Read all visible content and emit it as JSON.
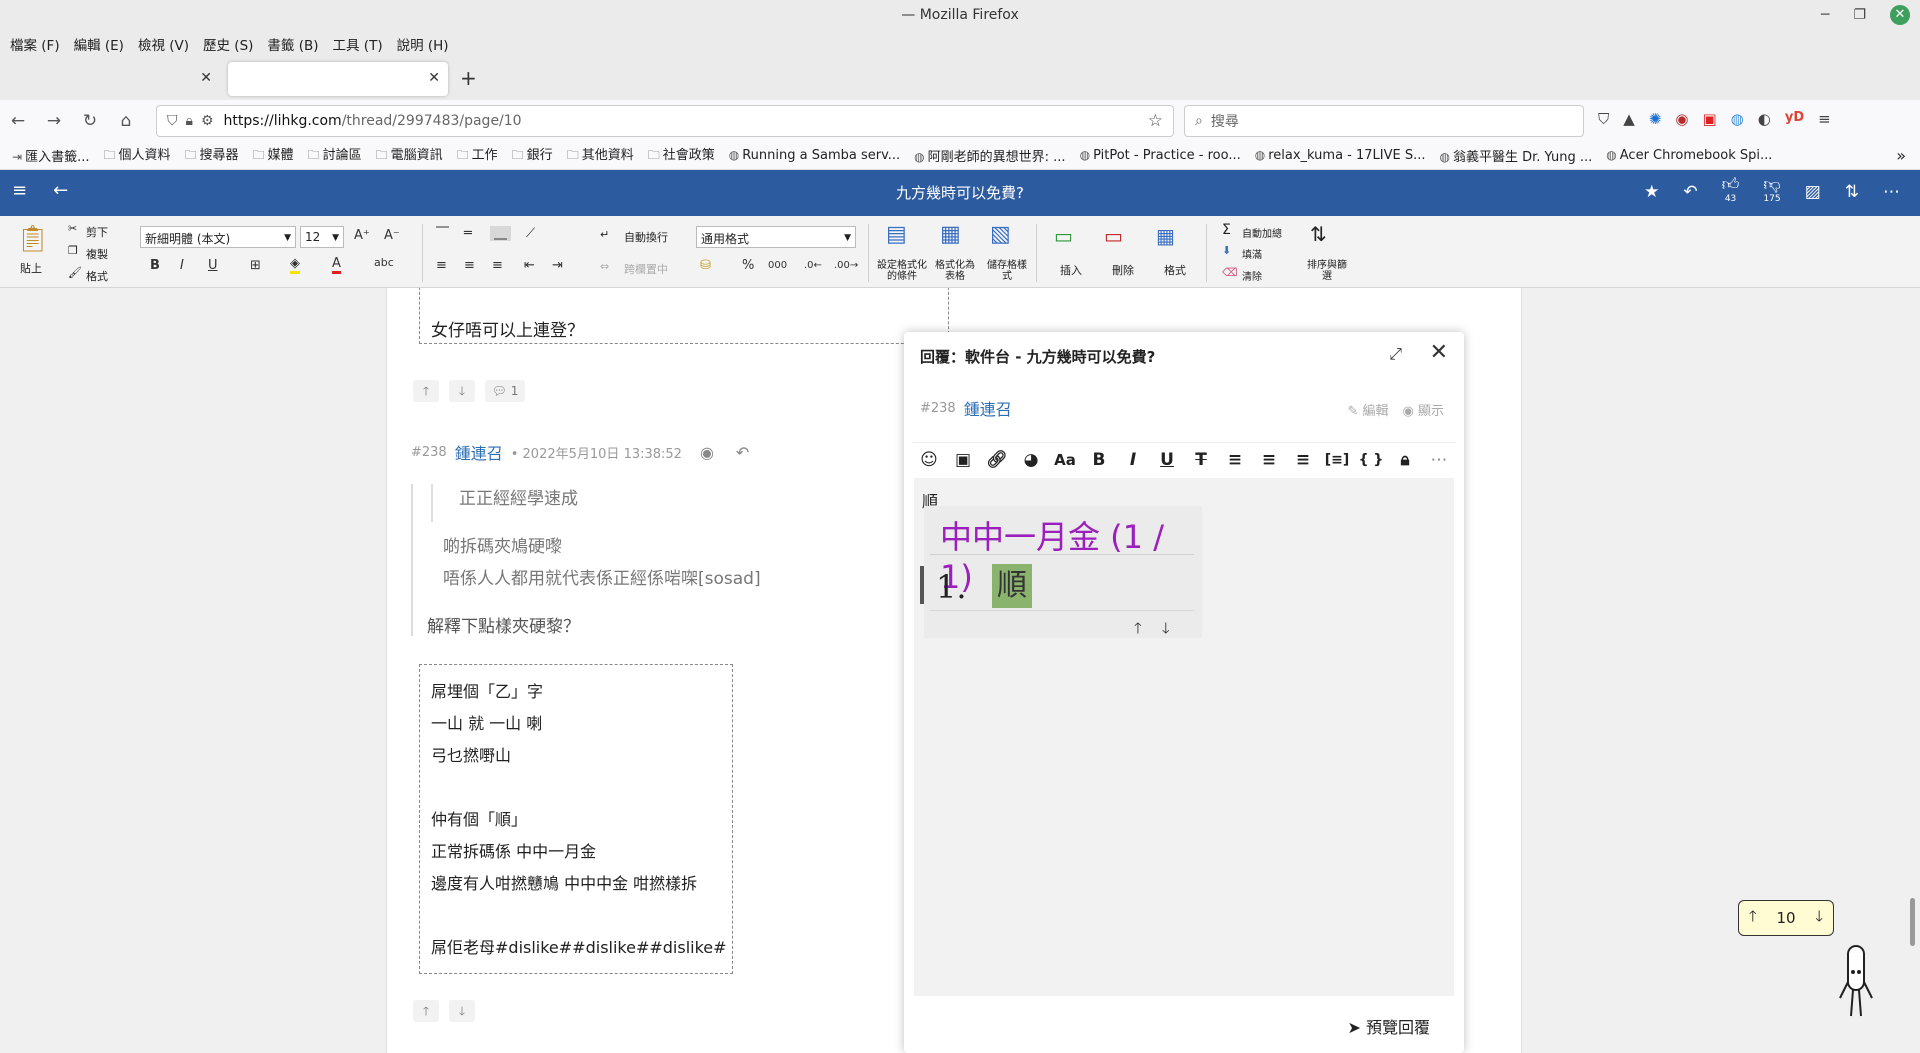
{
  "window": {
    "title": "— Mozilla Firefox"
  },
  "menu": [
    "檔案 (F)",
    "編輯 (E)",
    "檢視 (V)",
    "歷史 (S)",
    "書籤 (B)",
    "工具 (T)",
    "說明 (H)"
  ],
  "tabs": {
    "close_glyph": "✕",
    "new_tab": "+"
  },
  "urlbar": {
    "host": "https://lihkg.com",
    "path": "/thread/2997483/page/10"
  },
  "searchbar": {
    "placeholder": "搜尋"
  },
  "bookmarks": [
    {
      "icon": "import-icon",
      "label": "匯入書籤..."
    },
    {
      "icon": "folder-icon",
      "label": "個人資料"
    },
    {
      "icon": "folder-icon",
      "label": "搜尋器"
    },
    {
      "icon": "folder-icon",
      "label": "媒體"
    },
    {
      "icon": "folder-icon",
      "label": "討論區"
    },
    {
      "icon": "folder-icon",
      "label": "電腦資訊"
    },
    {
      "icon": "folder-icon",
      "label": "工作"
    },
    {
      "icon": "folder-icon",
      "label": "銀行"
    },
    {
      "icon": "folder-icon",
      "label": "其他資料"
    },
    {
      "icon": "folder-icon",
      "label": "社會政策"
    },
    {
      "icon": "globe-icon",
      "label": "Running a Samba serv..."
    },
    {
      "icon": "globe-icon",
      "label": "阿剛老師的異想世界: ..."
    },
    {
      "icon": "globe-icon",
      "label": "PitPot - Practice - roo..."
    },
    {
      "icon": "globe-icon",
      "label": "relax_kuma - 17LIVE S..."
    },
    {
      "icon": "globe-icon",
      "label": "翁義平醫生 Dr. Yung ..."
    },
    {
      "icon": "globe-icon",
      "label": "Acer Chromebook Spi..."
    }
  ],
  "lihkg": {
    "thread_title": "九方幾時可以免費?",
    "likes": "43",
    "dislikes": "175"
  },
  "ribbon": {
    "paste": "貼上",
    "cut": "剪下",
    "copy": "複製",
    "format_painter": "格式",
    "font_name": "新細明體 (本文)",
    "font_size": "12",
    "wrap_text": "自動換行",
    "merge_center": "跨欄置中",
    "number_format": "通用格式",
    "cond_format": "設定格式化的條件",
    "format_as_table": "格式化為表格",
    "cell_styles": "儲存格樣式",
    "insert": "插入",
    "delete": "刪除",
    "format": "格式",
    "autosum": "自動加總",
    "fill": "填滿",
    "clear": "清除",
    "sort_filter": "排序與篩選"
  },
  "posts": {
    "prev_text": "女仔唔可以上連登？",
    "prev_reply_count": "1",
    "p238": {
      "number": "#238",
      "user": "鍾連召",
      "timestamp": "• 2022年5月10日 13:38:52",
      "nested_quote": "正正經經學速成",
      "quote_line1": "啲拆碼夾鳩硬嚟",
      "quote_line2": "唔係人人都用就代表係正經係啱㗎[sosad]",
      "reply_line": "解釋下點樣夾硬黎？",
      "box_lines": [
        "屌埋個「乙」字",
        "一山 就 一山 喇",
        "弓乜撚嘢山",
        "",
        "仲有個「順」",
        "正常拆碼係 中中一月金",
        "邊度有人咁撚戇鳩 中中中金 咁撚樣拆",
        "",
        "屌佢老母#dislike##dislike##dislike#"
      ]
    }
  },
  "reply_panel": {
    "title": "回覆：軟件台 - 九方幾時可以免費?",
    "post_number": "#238",
    "user": "鍾連召",
    "edit": "編輯",
    "show": "顯示",
    "editor_first_line": "順",
    "card_heading": "中中一月金 (1 / 1)",
    "card_number": "1.",
    "card_answer": "順",
    "preview": "預覽回覆"
  },
  "page_nav": {
    "page": "10"
  }
}
